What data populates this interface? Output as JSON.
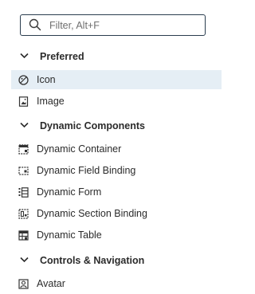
{
  "search": {
    "placeholder": "Filter, Alt+F",
    "value": ""
  },
  "sections": [
    {
      "label": "Preferred",
      "expanded": true,
      "items": [
        {
          "label": "Icon",
          "icon": "icon-component-icon",
          "selected": true
        },
        {
          "label": "Image",
          "icon": "image-component-icon",
          "selected": false
        }
      ]
    },
    {
      "label": "Dynamic Components",
      "expanded": true,
      "items": [
        {
          "label": "Dynamic Container",
          "icon": "dynamic-container-icon"
        },
        {
          "label": "Dynamic Field Binding",
          "icon": "dynamic-field-binding-icon"
        },
        {
          "label": "Dynamic Form",
          "icon": "dynamic-form-icon"
        },
        {
          "label": "Dynamic Section Binding",
          "icon": "dynamic-section-binding-icon"
        },
        {
          "label": "Dynamic Table",
          "icon": "dynamic-table-icon"
        }
      ]
    },
    {
      "label": "Controls & Navigation",
      "expanded": true,
      "items": [
        {
          "label": "Avatar",
          "icon": "avatar-icon"
        }
      ]
    }
  ]
}
